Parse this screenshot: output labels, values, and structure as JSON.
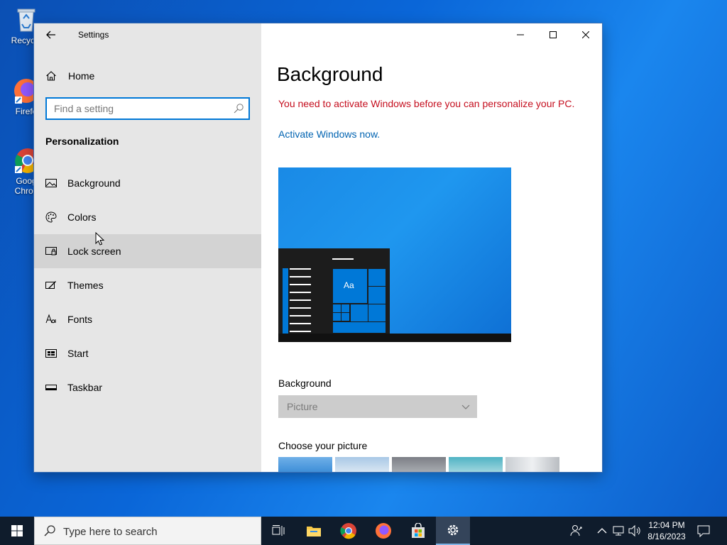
{
  "desktop": {
    "icons": [
      {
        "label": "Recycle"
      },
      {
        "label": "Firefo"
      },
      {
        "label": "Goog\nChron"
      }
    ]
  },
  "window": {
    "title": "Settings",
    "sidebar": {
      "home_label": "Home",
      "search_placeholder": "Find a setting",
      "section_title": "Personalization",
      "items": [
        {
          "label": "Background",
          "icon": "image-icon"
        },
        {
          "label": "Colors",
          "icon": "palette-icon"
        },
        {
          "label": "Lock screen",
          "icon": "lock-screen-icon"
        },
        {
          "label": "Themes",
          "icon": "themes-icon"
        },
        {
          "label": "Fonts",
          "icon": "fonts-icon"
        },
        {
          "label": "Start",
          "icon": "start-icon"
        },
        {
          "label": "Taskbar",
          "icon": "taskbar-icon"
        }
      ]
    },
    "content": {
      "page_title": "Background",
      "warning": "You need to activate Windows before you can personalize your PC.",
      "activate_link": "Activate Windows now.",
      "preview_sample_text": "Aa",
      "background_label": "Background",
      "background_value": "Picture",
      "choose_picture_label": "Choose your picture"
    }
  },
  "taskbar": {
    "search_placeholder": "Type here to search",
    "clock_time": "12:04 PM",
    "clock_date": "8/16/2023"
  },
  "colors": {
    "accent": "#0078d7",
    "warning": "#c50f1f",
    "link": "#0063b1"
  }
}
